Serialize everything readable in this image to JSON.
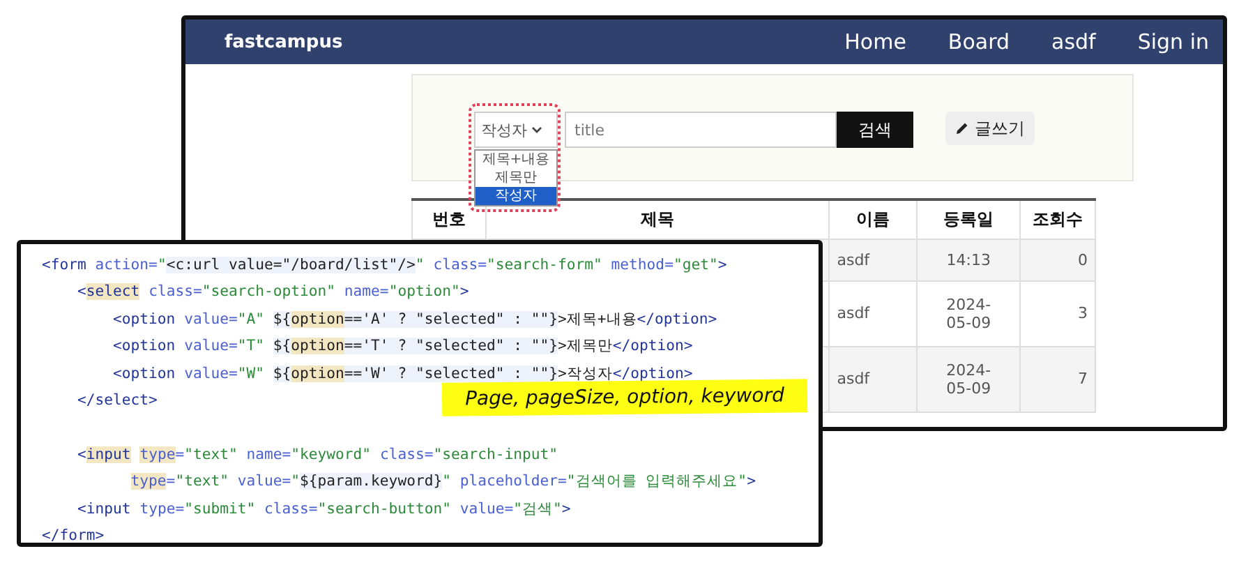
{
  "browser": {
    "navbar": {
      "brand": "fastcampus",
      "links": [
        "Home",
        "Board",
        "asdf",
        "Sign in"
      ]
    },
    "search": {
      "select": {
        "value": "작성자",
        "expanded": true,
        "options": [
          {
            "label": "제목+내용",
            "selected": false
          },
          {
            "label": "제목만",
            "selected": false
          },
          {
            "label": "작성자",
            "selected": true
          }
        ]
      },
      "input": {
        "value": "title"
      },
      "search_button": "검색",
      "write_button": "글쓰기"
    },
    "table": {
      "columns": [
        "번호",
        "제목",
        "이름",
        "등록일",
        "조회수"
      ],
      "rows": [
        {
          "name": "asdf",
          "date": "14:13",
          "views": "0"
        },
        {
          "name": "asdf",
          "date": "2024-05-09",
          "views": "3"
        },
        {
          "name": "asdf",
          "date": "2024-05-09",
          "views": "7"
        }
      ]
    }
  },
  "code": {
    "blocks": [
      [
        [
          {
            "kind": "tag",
            "text": "<form"
          },
          {
            "kind": "attr",
            "text": " action="
          },
          {
            "kind": "str",
            "text": "\""
          },
          {
            "kind": "expr",
            "text": "<c:url value=\"/board/list\"/>"
          },
          {
            "kind": "str",
            "text": "\""
          },
          {
            "kind": "attr",
            "text": " class="
          },
          {
            "kind": "str",
            "text": "\"search-form\""
          },
          {
            "kind": "attr",
            "text": " method="
          },
          {
            "kind": "str",
            "text": "\"get\""
          },
          {
            "kind": "tag",
            "text": ">"
          }
        ],
        [
          {
            "kind": "tag",
            "text": "    <"
          },
          {
            "kind": "tag-hl",
            "text": "select"
          },
          {
            "kind": "attr",
            "text": " class="
          },
          {
            "kind": "str",
            "text": "\"search-option\""
          },
          {
            "kind": "attr",
            "text": " name="
          },
          {
            "kind": "str",
            "text": "\"option\""
          },
          {
            "kind": "tag",
            "text": ">"
          }
        ],
        [
          {
            "kind": "tag",
            "text": "        <option"
          },
          {
            "kind": "attr",
            "text": " value="
          },
          {
            "kind": "str",
            "text": "\"A\" "
          },
          {
            "kind": "expr",
            "text": "${"
          },
          {
            "kind": "var-hl",
            "text": "option"
          },
          {
            "kind": "expr",
            "text": "=='A' ? \"selected\" : \"\"}"
          },
          {
            "kind": "plain",
            "text": ">제목+내용"
          },
          {
            "kind": "tag",
            "text": "</option>"
          }
        ],
        [
          {
            "kind": "tag",
            "text": "        <option"
          },
          {
            "kind": "attr",
            "text": " value="
          },
          {
            "kind": "str",
            "text": "\"T\" "
          },
          {
            "kind": "expr",
            "text": "${"
          },
          {
            "kind": "var-hl",
            "text": "option"
          },
          {
            "kind": "expr",
            "text": "=='T' ? \"selected\" : \"\"}"
          },
          {
            "kind": "plain",
            "text": ">제목만"
          },
          {
            "kind": "tag",
            "text": "</option>"
          }
        ],
        [
          {
            "kind": "tag",
            "text": "        <option"
          },
          {
            "kind": "attr",
            "text": " value="
          },
          {
            "kind": "str",
            "text": "\"W\" "
          },
          {
            "kind": "expr",
            "text": "${"
          },
          {
            "kind": "var-hl",
            "text": "option"
          },
          {
            "kind": "expr",
            "text": "=='W' ? \"selected\" : \"\"}"
          },
          {
            "kind": "plain",
            "text": ">작성자"
          },
          {
            "kind": "tag",
            "text": "</option>"
          }
        ],
        [
          {
            "kind": "tag",
            "text": "    </select>"
          }
        ]
      ],
      [
        [
          {
            "kind": "tag",
            "text": "    <"
          },
          {
            "kind": "tag-hl",
            "text": "input"
          },
          {
            "kind": "attr-hl",
            "text": " type"
          },
          {
            "kind": "attr",
            "text": "="
          },
          {
            "kind": "str",
            "text": "\"text\""
          },
          {
            "kind": "attr",
            "text": " name="
          },
          {
            "kind": "str",
            "text": "\"keyword\""
          },
          {
            "kind": "attr",
            "text": " class="
          },
          {
            "kind": "str",
            "text": "\"search-input\""
          }
        ],
        [
          {
            "kind": "attr-hl",
            "text": "          type"
          },
          {
            "kind": "attr",
            "text": "="
          },
          {
            "kind": "str",
            "text": "\"text\""
          },
          {
            "kind": "attr",
            "text": " value="
          },
          {
            "kind": "str",
            "text": "\""
          },
          {
            "kind": "expr",
            "text": "${param.keyword}"
          },
          {
            "kind": "str",
            "text": "\""
          },
          {
            "kind": "attr",
            "text": " placeholder="
          },
          {
            "kind": "str",
            "text": "\"검색어를 입력해주세요\""
          },
          {
            "kind": "tag",
            "text": ">"
          }
        ],
        [
          {
            "kind": "tag",
            "text": "    <input"
          },
          {
            "kind": "attr",
            "text": " type="
          },
          {
            "kind": "str",
            "text": "\"submit\""
          },
          {
            "kind": "attr",
            "text": " class="
          },
          {
            "kind": "str",
            "text": "\"search-button\""
          },
          {
            "kind": "attr",
            "text": " value="
          },
          {
            "kind": "str",
            "text": "\"검색\""
          },
          {
            "kind": "tag",
            "text": ">"
          }
        ],
        [
          {
            "kind": "tag",
            "text": "</form>"
          }
        ]
      ]
    ]
  },
  "note": "Page, pageSize, option, keyword"
}
